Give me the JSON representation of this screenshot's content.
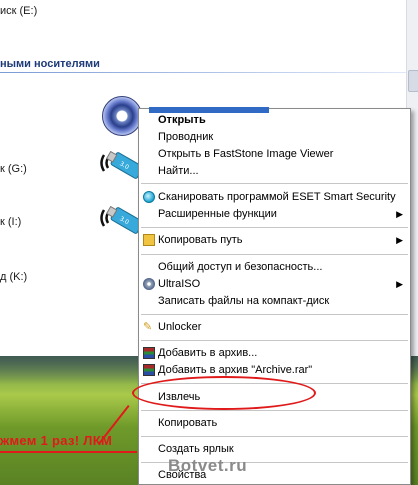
{
  "explorer": {
    "drive_e": "иск (E:)",
    "section_title": "ными носителями",
    "drive_g": "к (G:)",
    "drive_i": "к (I:)",
    "drive_k": "д (K:)"
  },
  "menu": {
    "items": [
      {
        "label": "Открыть",
        "bold": true
      },
      {
        "label": "Проводник"
      },
      {
        "label": "Открыть в  FastStone Image Viewer"
      },
      {
        "label": "Найти..."
      },
      {
        "label": "Сканировать программой ESET Smart Security",
        "icon": "eset-icon"
      },
      {
        "label": "Расширенные функции",
        "submenu": true
      },
      {
        "label": "Копировать путь",
        "icon": "folder-icon",
        "submenu": true
      },
      {
        "label": "Общий доступ и безопасность..."
      },
      {
        "label": "UltraISO",
        "icon": "ultraiso-icon",
        "submenu": true
      },
      {
        "label": "Записать файлы на компакт-диск"
      },
      {
        "label": "Unlocker",
        "icon": "unlocker-icon"
      },
      {
        "label": "Добавить в архив...",
        "icon": "winrar-icon"
      },
      {
        "label": "Добавить в архив \"Archive.rar\"",
        "icon": "winrar-icon"
      },
      {
        "label": "Извлечь"
      },
      {
        "label": "Копировать"
      },
      {
        "label": "Создать ярлык"
      },
      {
        "label": "Свойства"
      }
    ],
    "submenu_arrow": "▶"
  },
  "annotation": {
    "hint": "жмем 1 раз! ЛКМ",
    "watermark": "Botvet.ru",
    "color": "#e01a1a"
  },
  "colors": {
    "selection": "#316ac5",
    "section_title": "#1e3a78"
  }
}
